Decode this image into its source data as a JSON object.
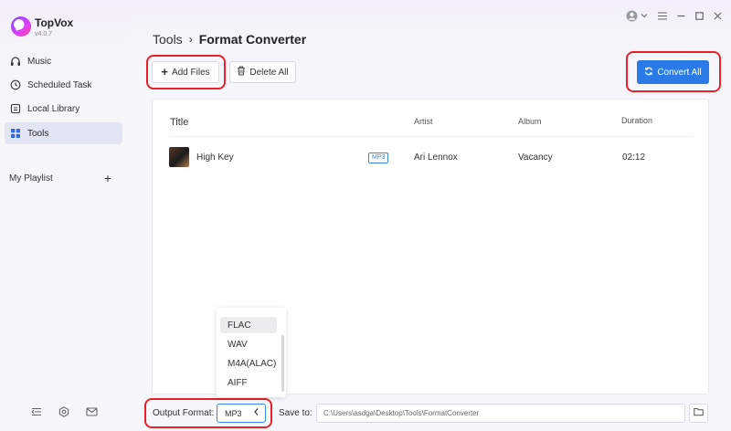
{
  "app": {
    "name": "TopVox",
    "version": "v4.0.7"
  },
  "sidebar": {
    "items": [
      {
        "label": "Music",
        "icon": "headphones-icon"
      },
      {
        "label": "Scheduled Task",
        "icon": "clock-icon"
      },
      {
        "label": "Local Library",
        "icon": "library-icon"
      },
      {
        "label": "Tools",
        "icon": "grid-icon",
        "active": true
      }
    ],
    "playlist_label": "My Playlist",
    "add_symbol": "+"
  },
  "header": {
    "breadcrumb_root": "Tools",
    "breadcrumb_sep": "›",
    "breadcrumb_current": "Format Converter"
  },
  "toolbar": {
    "add_files_label": "Add Files",
    "delete_all_label": "Delete All",
    "convert_all_label": "Convert All"
  },
  "table": {
    "columns": [
      "Title",
      "Artist",
      "Album",
      "Duration"
    ],
    "rows": [
      {
        "title": "High Key",
        "format": "MP3",
        "artist": "Ari Lennox",
        "album": "Vacancy",
        "duration": "02:12"
      }
    ]
  },
  "bottom": {
    "output_format_label": "Output Format:",
    "output_format_value": "MP3",
    "save_to_label": "Save to:",
    "save_path": "C:\\Users\\asdga\\Desktop\\Tools\\FormatConverter"
  },
  "format_dropdown": {
    "options": [
      "FLAC",
      "WAV",
      "M4A(ALAC)",
      "AIFF"
    ],
    "highlighted": "FLAC"
  },
  "colors": {
    "accent": "#2a7be8",
    "highlight_ring": "#e8202a",
    "active_nav_bg": "#e1e6f2"
  }
}
